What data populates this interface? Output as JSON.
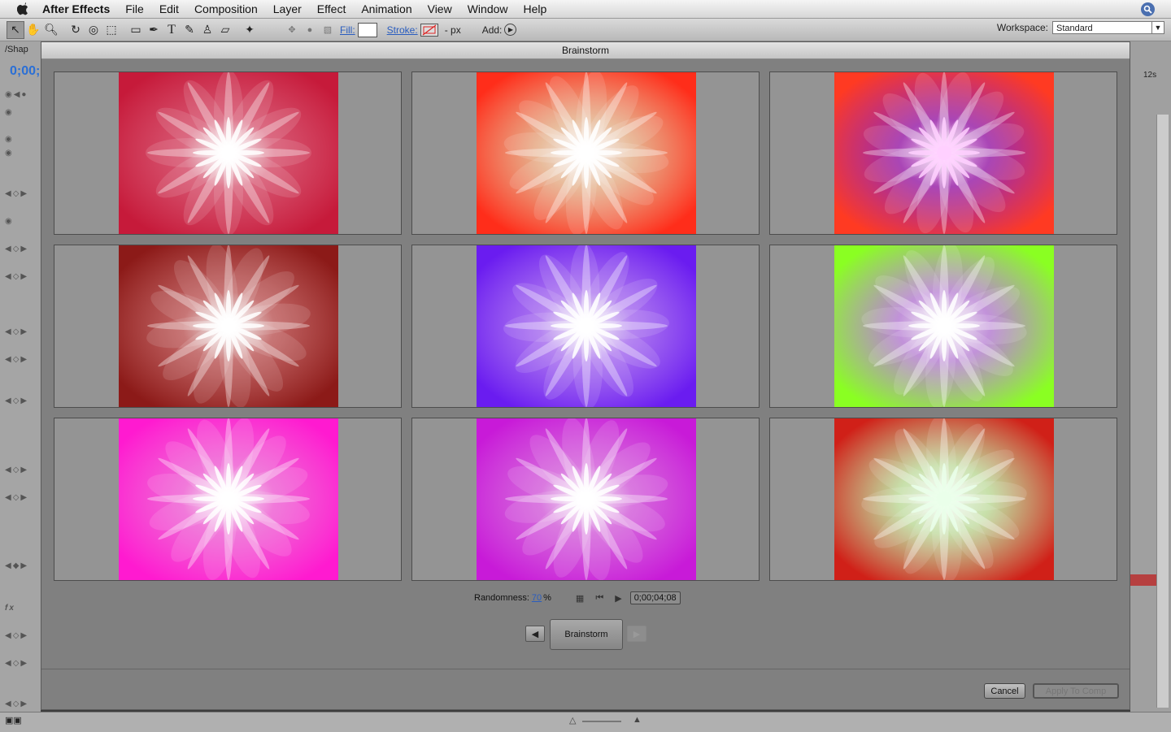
{
  "menubar": {
    "app_name": "After Effects",
    "items": [
      "File",
      "Edit",
      "Composition",
      "Layer",
      "Effect",
      "Animation",
      "View",
      "Window",
      "Help"
    ]
  },
  "toolbar": {
    "fill_label": "Fill:",
    "stroke_label": "Stroke:",
    "stroke_unit": "- px",
    "add_label": "Add:",
    "workspace_label": "Workspace:",
    "workspace_value": "Standard"
  },
  "background": {
    "panel_tab": "/Shap",
    "timecode": "0;00;",
    "time_marker": "12s"
  },
  "dialog": {
    "title": "Brainstorm",
    "randomness_label": "Randomness:",
    "randomness_value": "70",
    "randomness_unit": "%",
    "timecode": "0;00;04;08",
    "brainstorm_button": "Brainstorm",
    "cancel_button": "Cancel",
    "apply_button": "Apply To Comp"
  },
  "variants": [
    {
      "bg": "#c61a3a",
      "glow": "#e24a6a",
      "core": "#ffffff"
    },
    {
      "bg": "#ff2d1a",
      "glow": "#f4b98e",
      "core": "#ffffff"
    },
    {
      "bg": "#ff3a22",
      "glow": "#a01ab0",
      "core": "#ffd0ff"
    },
    {
      "bg": "#8c1a18",
      "glow": "#c85a5a",
      "core": "#ffffff"
    },
    {
      "bg": "#6a1cf0",
      "glow": "#b070ff",
      "core": "#ffffff"
    },
    {
      "bg": "#8aff22",
      "glow": "#c080e0",
      "core": "#ffffff"
    },
    {
      "bg": "#ff1ad0",
      "glow": "#ff60e0",
      "core": "#ffffff"
    },
    {
      "bg": "#c81ad8",
      "glow": "#e060e8",
      "core": "#ffffff"
    },
    {
      "bg": "#d02018",
      "glow": "#c8e8a0",
      "core": "#eaffea"
    }
  ]
}
